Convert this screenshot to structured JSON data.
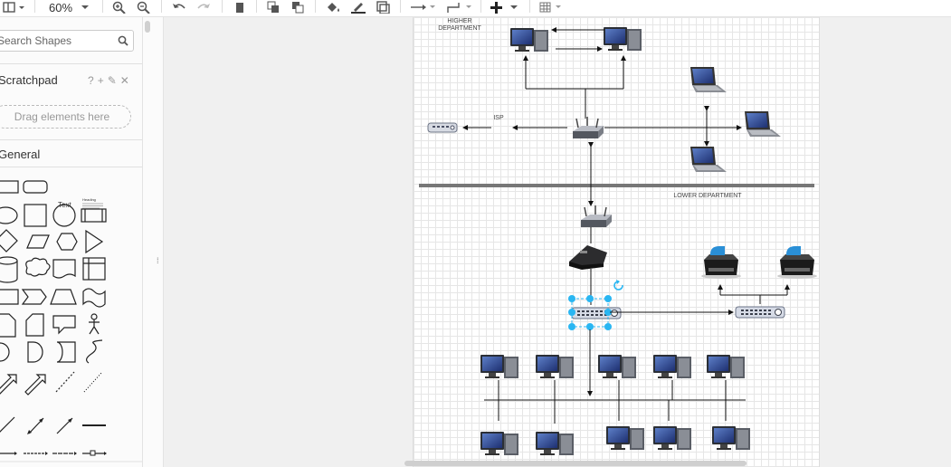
{
  "toolbar": {
    "zoom": "60%",
    "icons": [
      "format-panel-icon",
      "zoom-in-icon",
      "zoom-out-icon",
      "undo-icon",
      "redo-icon",
      "delete-icon",
      "to-front-icon",
      "to-back-icon",
      "fill-color-icon",
      "line-color-icon",
      "shadow-icon",
      "connection-icon",
      "waypoints-icon",
      "insert-icon",
      "table-icon"
    ]
  },
  "sidebar": {
    "search_placeholder": "Search Shapes",
    "scratchpad_title": "Scratchpad",
    "scratchpad_actions": [
      "?",
      "+",
      "✎",
      "✕"
    ],
    "drop_text": "Drag elements here",
    "general_title": "General",
    "text_shape_label": "Text",
    "heading_shape_label": "Heading"
  },
  "diagram": {
    "labels": {
      "higher_department": "HIGHER DEPARTMENT",
      "isp": "ISP",
      "lower_department": "LOWER DEPARTMENT"
    }
  }
}
